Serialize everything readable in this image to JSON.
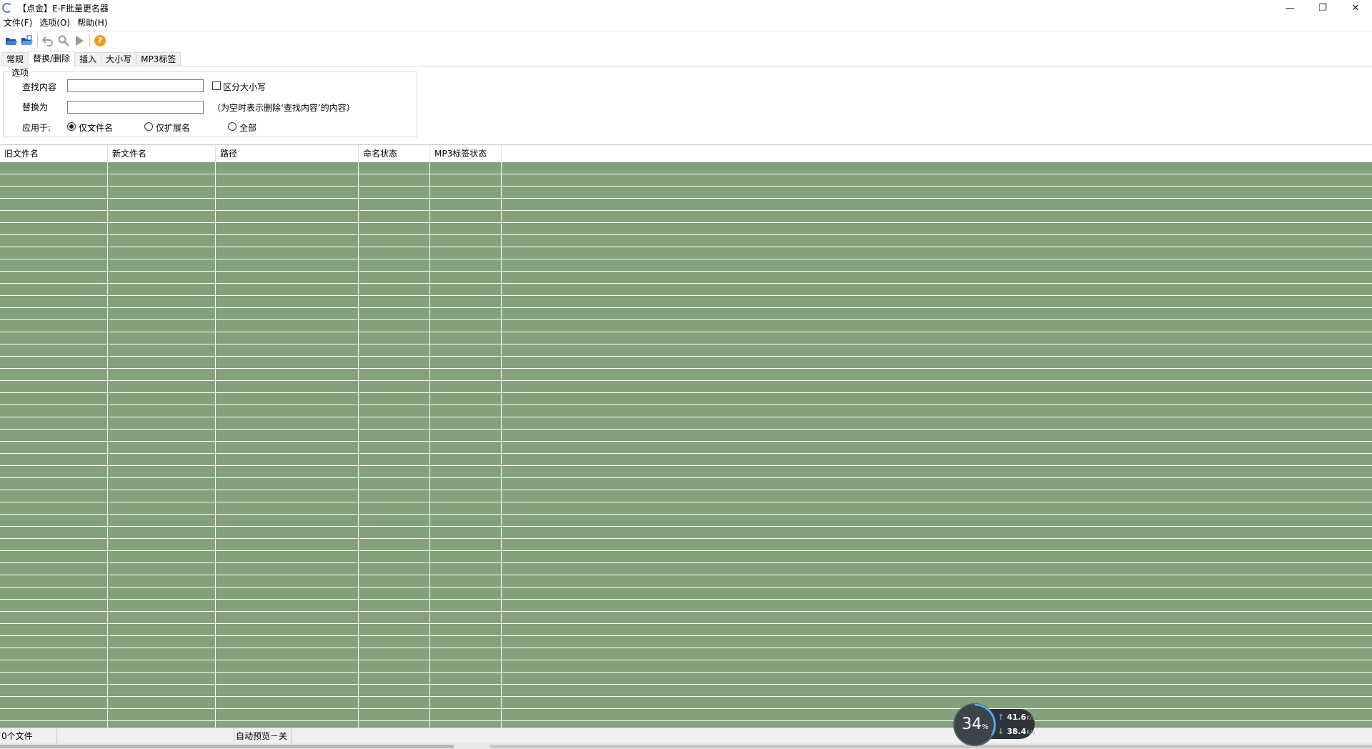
{
  "window": {
    "title": "【点金】E-F批量更名器",
    "minimize_glyph": "—",
    "restore_glyph": "❐",
    "close_glyph": "✕"
  },
  "menu": {
    "items": [
      "文件(F)",
      "选项(O)",
      "帮助(H)"
    ]
  },
  "toolbar": {
    "icons": [
      "open-folder-icon",
      "open-file-icon",
      "undo-icon",
      "search-icon",
      "run-icon",
      "help-icon"
    ],
    "help_glyph": "?"
  },
  "tabs": {
    "items": [
      "常规",
      "替换/删除",
      "插入",
      "大小写",
      "MP3标签"
    ],
    "active_index": 1
  },
  "options": {
    "legend": "选项",
    "find_label": "查找内容",
    "find_value": "",
    "case_label": "区分大小写",
    "case_checked": false,
    "replace_label": "替换为",
    "replace_value": "",
    "replace_hint": "（为空时表示删除‘查找内容’的内容）",
    "apply_label": "应用于:",
    "apply_options": [
      "仅文件名",
      "仅扩展名",
      "全部"
    ],
    "apply_selected_index": 0
  },
  "table": {
    "columns": [
      "旧文件名",
      "新文件名",
      "路径",
      "命名状态",
      "MP3标签状态"
    ],
    "row_color": "#84a17c"
  },
  "statusbar": {
    "file_count": "0个文件",
    "empty_pane": "",
    "preview": "自动预览－关"
  },
  "net_widget": {
    "percent": "34",
    "percent_unit": "%",
    "percent_value": 34,
    "upload": "41.6",
    "download": "38.4",
    "unit": "K/s"
  }
}
